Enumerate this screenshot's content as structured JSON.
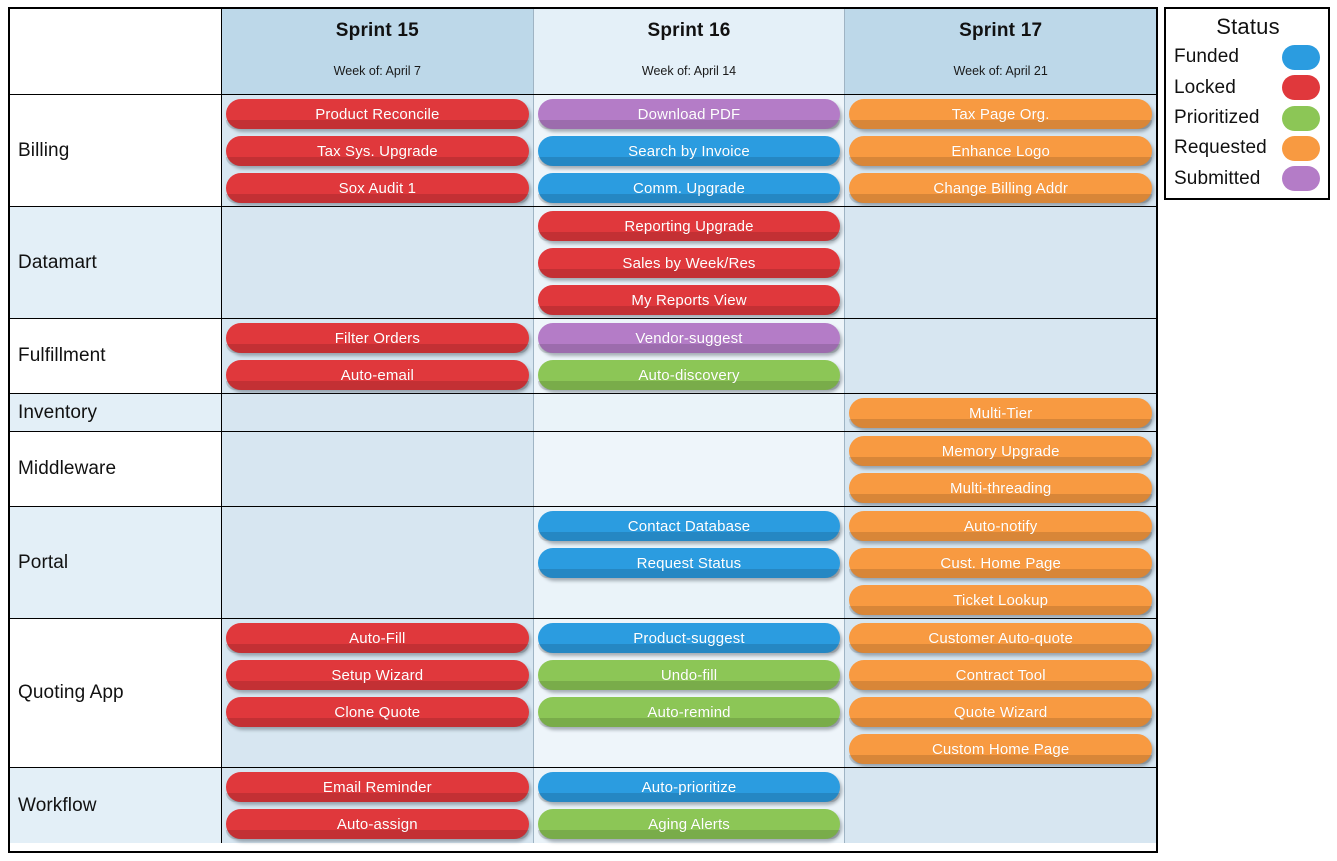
{
  "table": {
    "corner_label": "",
    "columns": [
      {
        "name": "Sprint 15",
        "week_of": "Week of: April 7"
      },
      {
        "name": "Sprint 16",
        "week_of": "Week of: April 14"
      },
      {
        "name": "Sprint 17",
        "week_of": "Week of: April 21"
      }
    ],
    "rows": [
      {
        "label": "Billing",
        "tint": "white",
        "cells": [
          [
            {
              "label": "Product Reconcile",
              "status": "Locked"
            },
            {
              "label": "Tax Sys. Upgrade",
              "status": "Locked"
            },
            {
              "label": "Sox Audit 1",
              "status": "Locked"
            }
          ],
          [
            {
              "label": "Download PDF",
              "status": "Submitted"
            },
            {
              "label": "Search by Invoice",
              "status": "Funded"
            },
            {
              "label": "Comm. Upgrade",
              "status": "Funded"
            }
          ],
          [
            {
              "label": "Tax Page Org.",
              "status": "Requested"
            },
            {
              "label": "Enhance Logo",
              "status": "Requested"
            },
            {
              "label": "Change Billing Addr",
              "status": "Requested"
            }
          ]
        ]
      },
      {
        "label": "Datamart",
        "tint": "blue",
        "cells": [
          [],
          [
            {
              "label": "Reporting Upgrade",
              "status": "Locked"
            },
            {
              "label": "Sales by Week/Res",
              "status": "Locked"
            },
            {
              "label": "My Reports View",
              "status": "Locked"
            }
          ],
          []
        ]
      },
      {
        "label": "Fulfillment",
        "tint": "white",
        "cells": [
          [
            {
              "label": "Filter Orders",
              "status": "Locked"
            },
            {
              "label": "Auto-email",
              "status": "Locked"
            }
          ],
          [
            {
              "label": "Vendor-suggest",
              "status": "Submitted"
            },
            {
              "label": "Auto-discovery",
              "status": "Prioritized"
            }
          ],
          []
        ]
      },
      {
        "label": "Inventory",
        "tint": "blue",
        "cells": [
          [],
          [],
          [
            {
              "label": "Multi-Tier",
              "status": "Requested"
            }
          ]
        ]
      },
      {
        "label": "Middleware",
        "tint": "white",
        "cells": [
          [],
          [],
          [
            {
              "label": "Memory Upgrade",
              "status": "Requested"
            },
            {
              "label": "Multi-threading",
              "status": "Requested"
            }
          ]
        ]
      },
      {
        "label": "Portal",
        "tint": "blue",
        "cells": [
          [],
          [
            {
              "label": "Contact Database",
              "status": "Funded"
            },
            {
              "label": "Request Status",
              "status": "Funded"
            }
          ],
          [
            {
              "label": "Auto-notify",
              "status": "Requested"
            },
            {
              "label": "Cust. Home Page",
              "status": "Requested"
            },
            {
              "label": "Ticket Lookup",
              "status": "Requested"
            }
          ]
        ]
      },
      {
        "label": "Quoting App",
        "tint": "white",
        "cells": [
          [
            {
              "label": "Auto-Fill",
              "status": "Locked"
            },
            {
              "label": "Setup Wizard",
              "status": "Locked"
            },
            {
              "label": "Clone Quote",
              "status": "Locked"
            }
          ],
          [
            {
              "label": "Product-suggest",
              "status": "Funded"
            },
            {
              "label": "Undo-fill",
              "status": "Prioritized"
            },
            {
              "label": "Auto-remind",
              "status": "Prioritized"
            }
          ],
          [
            {
              "label": "Customer Auto-quote",
              "status": "Requested"
            },
            {
              "label": "Contract Tool",
              "status": "Requested"
            },
            {
              "label": "Quote Wizard",
              "status": "Requested"
            },
            {
              "label": "Custom Home Page",
              "status": "Requested"
            }
          ]
        ]
      },
      {
        "label": "Workflow",
        "tint": "blue",
        "cells": [
          [
            {
              "label": "Email Reminder",
              "status": "Locked"
            },
            {
              "label": "Auto-assign",
              "status": "Locked"
            }
          ],
          [
            {
              "label": "Auto-prioritize",
              "status": "Funded"
            },
            {
              "label": "Aging Alerts",
              "status": "Prioritized"
            }
          ],
          []
        ]
      }
    ]
  },
  "legend": {
    "title": "Status",
    "items": [
      {
        "label": "Funded",
        "color": "#2b9ce0"
      },
      {
        "label": "Locked",
        "color": "#e0383c"
      },
      {
        "label": "Prioritized",
        "color": "#8cc656"
      },
      {
        "label": "Requested",
        "color": "#f89a41"
      },
      {
        "label": "Submitted",
        "color": "#b47cc7"
      }
    ]
  }
}
